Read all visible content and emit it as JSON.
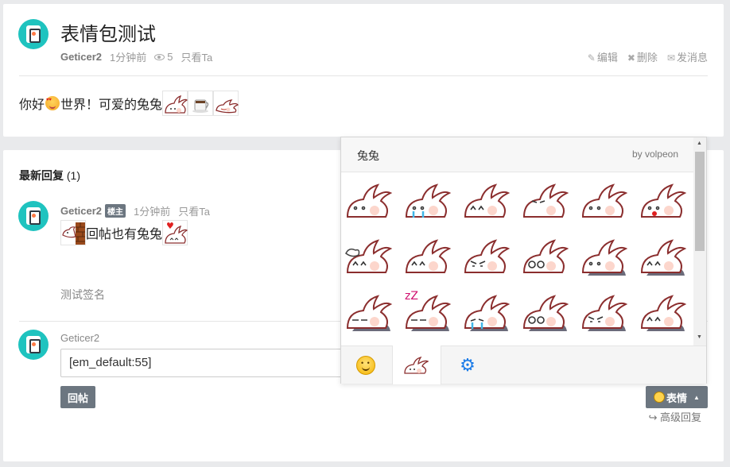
{
  "topic": {
    "title": "表情包测试",
    "author": "Geticer2",
    "time": "1分钟前",
    "views": "5",
    "only_view": "只看Ta",
    "actions": {
      "edit": "编辑",
      "delete": "删除",
      "message": "发消息"
    },
    "content_a": "你好",
    "content_b": "世界！可爱的兔兔"
  },
  "replies": {
    "title": "最新回复",
    "count": "(1)",
    "reply": {
      "author": "Geticer2",
      "badge": "楼主",
      "time": "1分钟前",
      "only_view": "只看Ta",
      "content": "回帖也有兔兔",
      "signature": "测试签名"
    }
  },
  "composer": {
    "user": "Geticer2",
    "input_value": "[em_default:55]",
    "submit_label": "回帖",
    "emoji_label": "表情",
    "advanced_label": "高级回复"
  },
  "emoji_panel": {
    "pack_name": "兔兔",
    "by": "by volpeon",
    "tabs": [
      "smile-icon",
      "bunny-icon",
      "gear-icon"
    ]
  }
}
